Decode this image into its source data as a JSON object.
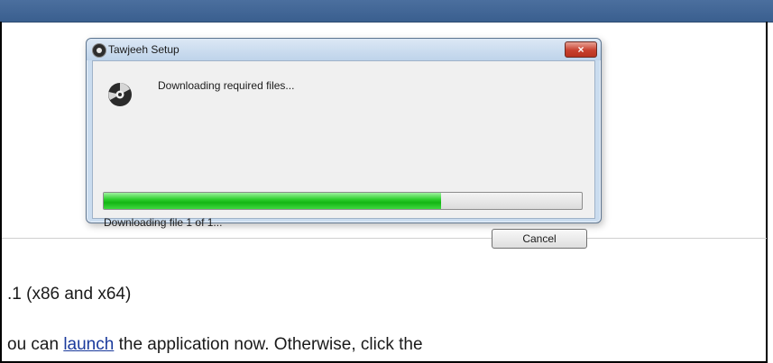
{
  "dialog": {
    "title": "Tawjeeh Setup",
    "status_message": "Downloading required files...",
    "progress_fraction": 0.705,
    "file_status": "Downloading file 1 of 1...",
    "cancel_label": "Cancel",
    "close_label": "×"
  },
  "page": {
    "version_text": ".1 (x86 and x64)",
    "launch_prefix": "ou can ",
    "launch_link": "launch",
    "launch_suffix": " the application now. Otherwise, click the"
  },
  "colors": {
    "topbar": "#3a5f8f",
    "progress_green": "#14b514",
    "link": "#1a3a9c"
  },
  "icons": {
    "title": "disc-icon",
    "body": "disc-icon"
  }
}
